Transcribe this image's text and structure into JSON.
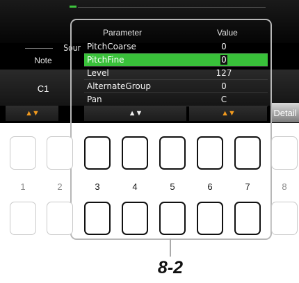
{
  "source": {
    "label": "Sour",
    "note_label": "Note",
    "note_value": "C1"
  },
  "table": {
    "header_param": "Parameter",
    "header_value": "Value",
    "rows": [
      {
        "name": "PitchCoarse",
        "value": "0"
      },
      {
        "name": "PitchFine",
        "value": "0"
      },
      {
        "name": "Level",
        "value": "127"
      },
      {
        "name": "AlternateGroup",
        "value": "0"
      },
      {
        "name": "Pan",
        "value": "C"
      }
    ]
  },
  "detail_label": "Detail",
  "arrows": {
    "left": "▲▼",
    "mid": "▲▼",
    "right": "▲▼"
  },
  "buttons": {
    "n1": "1",
    "n2": "2",
    "n3": "3",
    "n4": "4",
    "n5": "5",
    "n6": "6",
    "n7": "7",
    "n8": "8"
  },
  "callout": "8-2",
  "colors": {
    "selection": "#39c13a",
    "arrow_orange": "#f29a1e",
    "frame": "#b7b7b7"
  }
}
